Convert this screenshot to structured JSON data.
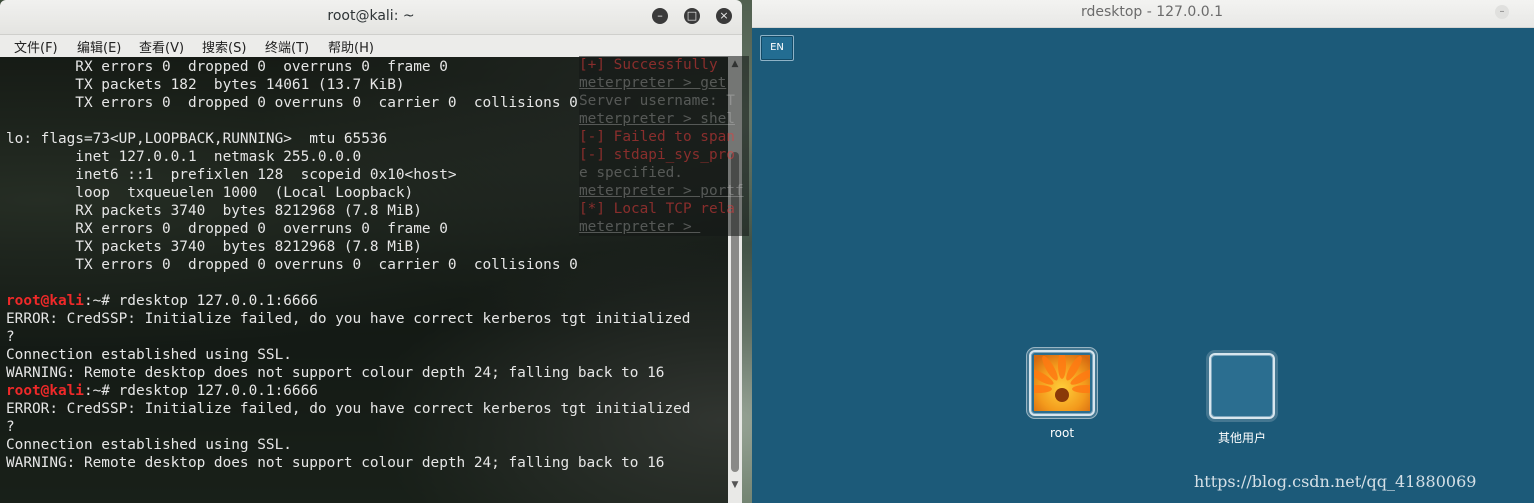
{
  "terminal": {
    "title": "root@kali: ~",
    "menu": [
      "文件(F)",
      "编辑(E)",
      "查看(V)",
      "搜索(S)",
      "终端(T)",
      "帮助(H)"
    ],
    "lines": [
      {
        "text": "        RX errors 0  dropped 0  overruns 0  frame 0"
      },
      {
        "text": "        TX packets 182  bytes 14061 (13.7 KiB)"
      },
      {
        "text": "        TX errors 0  dropped 0 overruns 0  carrier 0  collisions 0"
      },
      {
        "text": ""
      },
      {
        "text": "lo: flags=73<UP,LOOPBACK,RUNNING>  mtu 65536"
      },
      {
        "text": "        inet 127.0.0.1  netmask 255.0.0.0"
      },
      {
        "text": "        inet6 ::1  prefixlen 128  scopeid 0x10<host>"
      },
      {
        "text": "        loop  txqueuelen 1000  (Local Loopback)"
      },
      {
        "text": "        RX packets 3740  bytes 8212968 (7.8 MiB)"
      },
      {
        "text": "        RX errors 0  dropped 0  overruns 0  frame 0"
      },
      {
        "text": "        TX packets 3740  bytes 8212968 (7.8 MiB)"
      },
      {
        "text": "        TX errors 0  dropped 0 overruns 0  carrier 0  collisions 0"
      },
      {
        "text": ""
      },
      {
        "prompt_user": "root@kali",
        "prompt_path": ":~# ",
        "text": "rdesktop 127.0.0.1:6666"
      },
      {
        "text": "ERROR: CredSSP: Initialize failed, do you have correct kerberos tgt initialized"
      },
      {
        "text": "?"
      },
      {
        "text": "Connection established using SSL."
      },
      {
        "text": "WARNING: Remote desktop does not support colour depth 24; falling back to 16"
      },
      {
        "prompt_user": "root@kali",
        "prompt_path": ":~# ",
        "text": "rdesktop 127.0.0.1:6666"
      },
      {
        "text": "ERROR: CredSSP: Initialize failed, do you have correct kerberos tgt initialized"
      },
      {
        "text": "?"
      },
      {
        "text": "Connection established using SSL."
      },
      {
        "text": "WARNING: Remote desktop does not support colour depth 24; falling back to 16"
      }
    ]
  },
  "background_window": {
    "lines": [
      {
        "text": "[+] Successfully",
        "style": "red"
      },
      {
        "text": "meterpreter > get",
        "style": "und"
      },
      {
        "text": "Server username: T",
        "style": "plain"
      },
      {
        "text": "meterpreter > shel",
        "style": "und"
      },
      {
        "text": "[-] Failed to span",
        "style": "red"
      },
      {
        "text": "[-] stdapi_sys_pro",
        "style": "red"
      },
      {
        "text": "e specified.",
        "style": "plain"
      },
      {
        "text": "meterpreter > portf",
        "style": "und"
      },
      {
        "text": "[*] Local TCP rela",
        "style": "red"
      },
      {
        "text": "meterpreter > ",
        "style": "und"
      }
    ]
  },
  "rdesktop": {
    "title": "rdesktop - 127.0.0.1",
    "lang_button": "EN",
    "users": [
      {
        "name": "root"
      },
      {
        "name": "其他用户"
      }
    ]
  },
  "watermark": "https://blog.csdn.net/qq_41880069"
}
